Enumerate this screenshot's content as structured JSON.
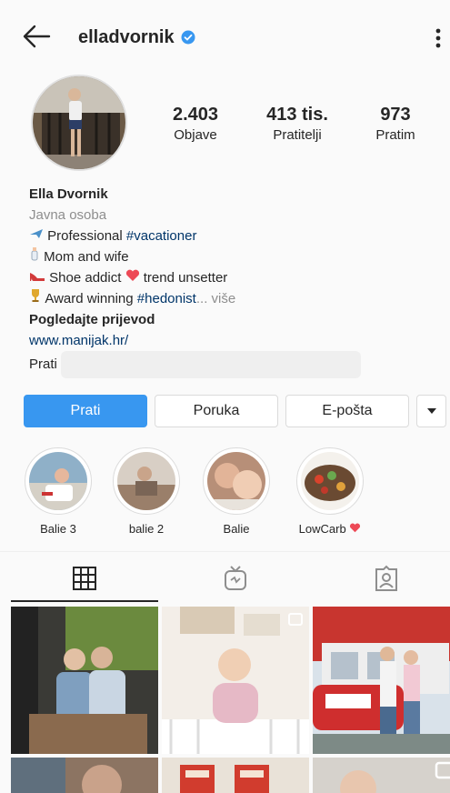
{
  "header": {
    "username": "elladvornik"
  },
  "stats": [
    {
      "value": "2.403",
      "label": "Objave"
    },
    {
      "value": "413 tis.",
      "label": "Pratitelji"
    },
    {
      "value": "973",
      "label": "Pratim"
    }
  ],
  "bio": {
    "name": "Ella Dvornik",
    "category": "Javna osoba",
    "line1_text": " Professional ",
    "line1_tag": "#vacationer",
    "line2_text": " Mom and wife",
    "line3_text_a": " Shoe addict ",
    "line3_text_b": " trend unsetter",
    "line4_text": " Award winning ",
    "line4_tag": "#hedonist",
    "line4_more": "... više",
    "translate": "Pogledajte prijevod",
    "website": "www.manijak.hr/",
    "followed_by": "Prati"
  },
  "actions": {
    "follow": "Prati",
    "message": "Poruka",
    "email": "E-pošta"
  },
  "highlights": [
    {
      "label": "Balie 3"
    },
    {
      "label": "balie 2"
    },
    {
      "label": "Balie"
    },
    {
      "label": "LowCarb"
    }
  ],
  "colors": {
    "accent": "#3897f0",
    "link": "#003569",
    "verified": "#3897f0",
    "heart": "#ed4956"
  },
  "icons": [
    "back-arrow-icon",
    "verified-badge-icon",
    "more-options-icon",
    "grid-tab-icon",
    "igtv-tab-icon",
    "tagged-tab-icon"
  ]
}
